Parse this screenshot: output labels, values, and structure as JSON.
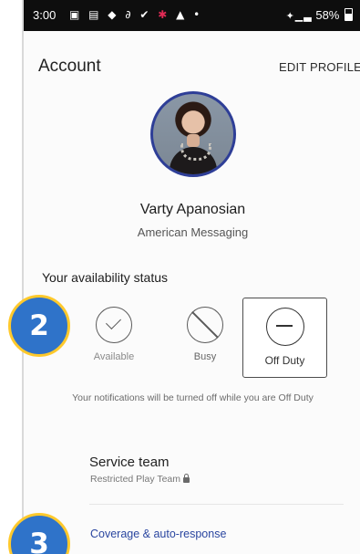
{
  "status_bar": {
    "time": "3:00",
    "left_icons": "▣ ▤ ◆ ∂ ✔",
    "left_icon_red": "✱",
    "left_icons_tail": "▲ •",
    "signal": "✦▁▃",
    "battery": "58%"
  },
  "header": {
    "title": "Account",
    "edit_profile": "EDIT PROFILE"
  },
  "profile": {
    "name": "Varty Apanosian",
    "organization": "American Messaging"
  },
  "availability": {
    "label": "Your availability status",
    "options": [
      {
        "label": "Available",
        "selected": false
      },
      {
        "label": "Busy",
        "selected": false
      },
      {
        "label": "Off Duty",
        "selected": true
      }
    ],
    "note": "Your notifications will be turned off while you are Off Duty"
  },
  "team": {
    "name": "Service team",
    "subtitle": "Restricted Play Team"
  },
  "coverage_link": "Coverage & auto-response",
  "badges": {
    "step_2": "2",
    "step_3": "3"
  },
  "colors": {
    "badge_fill": "#2f73c9",
    "badge_border": "#ffc92c",
    "avatar_ring": "#2e3e97",
    "link": "#2a46a0"
  }
}
